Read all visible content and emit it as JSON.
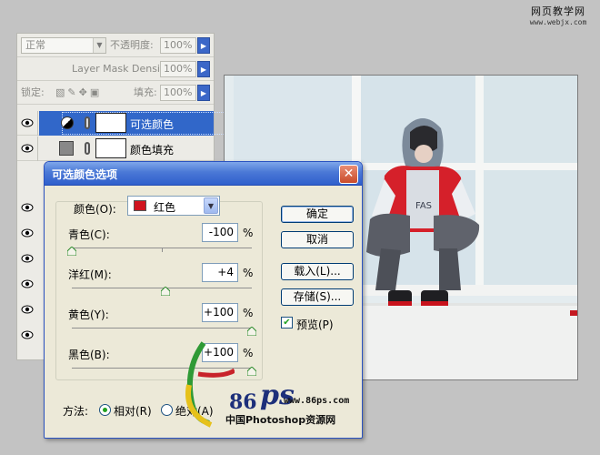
{
  "watermark": {
    "title": "网页教学网",
    "url": "www.webjx.com"
  },
  "layers_panel": {
    "blend_mode": "正常",
    "opacity_label": "不透明度:",
    "opacity_value": "100%",
    "mask_density_label": "Layer Mask Density",
    "mask_density_value": "100%",
    "lock_label": "锁定:",
    "fill_label": "填充:",
    "fill_value": "100%",
    "layers": [
      {
        "name": "可选颜色",
        "selected": true,
        "icon": "selective-color-adjustment-icon"
      },
      {
        "name": "颜色填充",
        "selected": false,
        "icon": "color-fill-icon"
      }
    ]
  },
  "dialog": {
    "title": "可选颜色选项",
    "color_label": "颜色(O):",
    "color_value": "红色",
    "color_swatch": "#d0131e",
    "sliders": [
      {
        "label": "青色(C):",
        "value": "-100",
        "unit": "%",
        "level": -100
      },
      {
        "label": "洋红(M):",
        "value": "+4",
        "unit": "%",
        "level": 4
      },
      {
        "label": "黄色(Y):",
        "value": "+100",
        "unit": "%",
        "level": 100
      },
      {
        "label": "黑色(B):",
        "value": "+100",
        "unit": "%",
        "level": 100
      }
    ],
    "buttons": {
      "ok": "确定",
      "cancel": "取消",
      "load": "载入(L)...",
      "save": "存储(S)..."
    },
    "preview": {
      "label": "预览(P)",
      "checked": true
    },
    "method": {
      "label": "方法:",
      "relative": "相对(R)",
      "absolute": "绝对(A)",
      "selected": "relative"
    }
  },
  "logo": {
    "number": "86",
    "letters": "ps",
    "url": "www.86ps.com",
    "caption": "中国Photoshop资源网"
  }
}
